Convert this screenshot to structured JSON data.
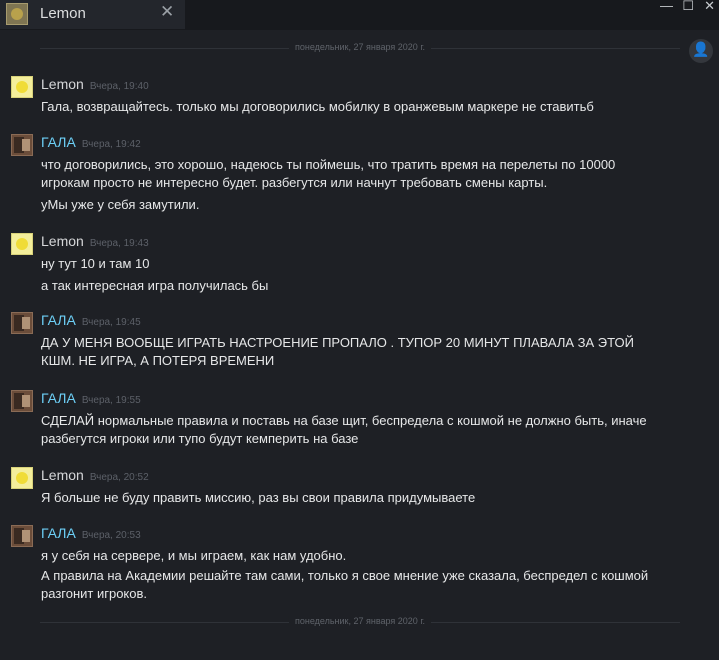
{
  "tab": {
    "title": "Lemon",
    "close": "✕"
  },
  "window_controls": {
    "minimize": "—",
    "maximize": "☐",
    "close": "✕"
  },
  "dividers": [
    "понедельник, 27 января 2020 г.",
    "понедельник, 27 января 2020 г."
  ],
  "messages": [
    {
      "sender": "Lemon",
      "time": "Вчера, 19:40",
      "lines": [
        "Гала, возвращайтесь. только мы договорились мобилку в оранжевым маркере не ставитьб"
      ]
    },
    {
      "sender": "ГАЛА",
      "time": "Вчера, 19:42",
      "lines": [
        "что договорились, это хорошо, надеюсь ты поймешь, что тратить время на перелеты по 10000",
        "игрокам просто не интересно будет. разбегутся или начнут требовать смены карты.",
        "уМы уже у себя замутили."
      ]
    },
    {
      "sender": "Lemon",
      "time": "Вчера, 19:43",
      "lines": [
        "ну тут 10 и там 10",
        "а так интересная игра получилась бы"
      ]
    },
    {
      "sender": "ГАЛА",
      "time": "Вчера, 19:45",
      "lines": [
        "ДА У МЕНЯ ВООБЩЕ ИГРАТЬ НАСТРОЕНИЕ ПРОПАЛО . ТУПОР 20 МИНУТ ПЛАВАЛА ЗА ЭТОЙ",
        "КШМ. НЕ ИГРА, А ПОТЕРЯ ВРЕМЕНИ"
      ]
    },
    {
      "sender": "ГАЛА",
      "time": "Вчера, 19:55",
      "lines": [
        "СДЕЛАЙ нормальные правила и поставь на базе щит, беспредела с кошмой не должно быть, иначе",
        "разбегутся игроки или тупо будут кемперить на базе"
      ]
    },
    {
      "sender": "Lemon",
      "time": "Вчера, 20:52",
      "lines": [
        "Я больше не буду править миссию, раз вы свои правила придумываете"
      ]
    },
    {
      "sender": "ГАЛА",
      "time": "Вчера, 20:53",
      "lines": [
        "я у себя на сервере, и мы играем, как нам удобно.",
        "А правила на Академии решайте там сами, только я свое мнение уже сказала, беспредел с кошмой",
        "разгонит игроков."
      ]
    }
  ]
}
